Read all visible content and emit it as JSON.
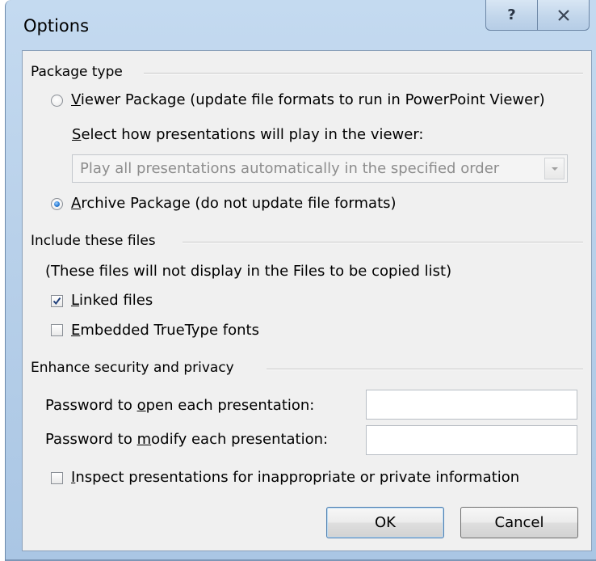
{
  "window": {
    "title": "Options",
    "help_glyph": "?",
    "close_glyph": "✕"
  },
  "package_type": {
    "heading": "Package type",
    "viewer_accesskey": "V",
    "viewer_label_rest": "iewer Package (update file formats to run in PowerPoint Viewer)",
    "viewer_selected": false,
    "play_accesskey": "S",
    "play_label_rest": "elect how presentations will play in the viewer:",
    "play_select_value": "Play all presentations automatically in the specified order",
    "archive_accesskey": "A",
    "archive_label_rest": "rchive Package (do not update file formats)",
    "archive_selected": true
  },
  "include_files": {
    "heading": "Include these files",
    "note": "(These files will not display in the Files to be copied list)",
    "linked_accesskey": "L",
    "linked_label_rest": "inked files",
    "linked_checked": true,
    "embedded_accesskey": "E",
    "embedded_label_rest": "mbedded TrueType fonts",
    "embedded_checked": false
  },
  "security": {
    "heading": "Enhance security and privacy",
    "open_label_pre": "Password to ",
    "open_accesskey": "o",
    "open_label_post": "pen each presentation:",
    "open_value": "",
    "modify_label_pre": "Password to ",
    "modify_accesskey": "m",
    "modify_label_post": "odify each presentation:",
    "modify_value": "",
    "inspect_accesskey": "I",
    "inspect_label_rest": "nspect presentations for inappropriate or private information",
    "inspect_checked": false
  },
  "buttons": {
    "ok": "OK",
    "cancel": "Cancel"
  },
  "colors": {
    "frame": "#b9d1ea",
    "client": "#f0f0f0",
    "radio_dot": "#2d7fd6",
    "check_mark": "#1f3f7a"
  },
  "icons": {
    "help": "help-icon",
    "close": "close-icon",
    "dropdown": "chevron-down-icon",
    "check": "checkmark-icon"
  }
}
